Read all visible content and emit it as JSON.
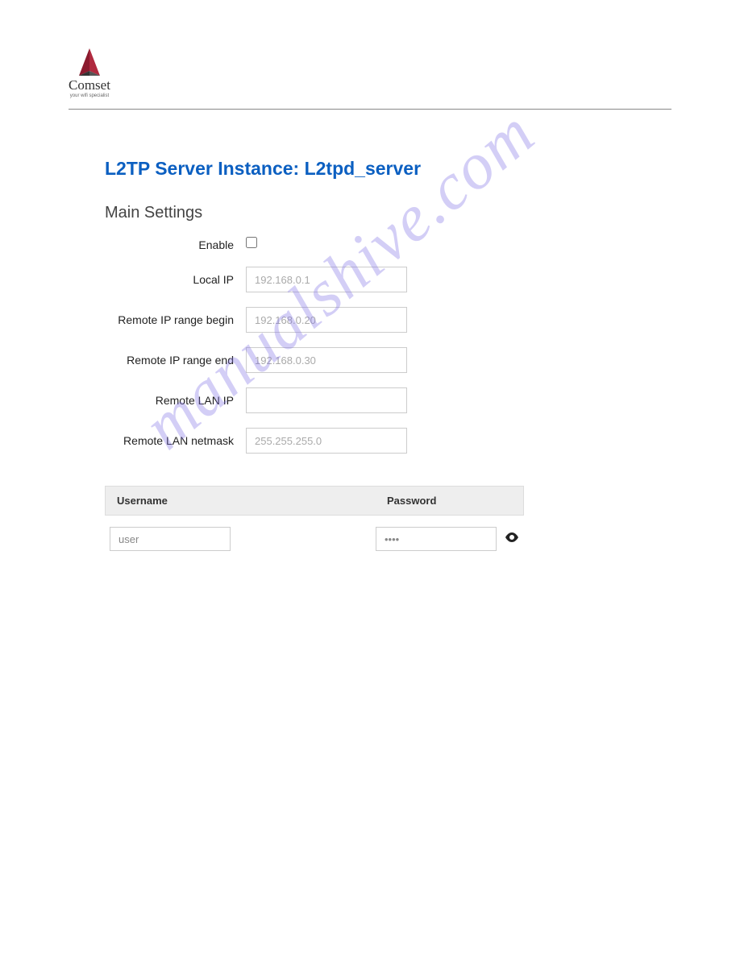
{
  "brand": {
    "name": "Comset",
    "tagline": "your wifi specialist"
  },
  "page": {
    "title": "L2TP Server Instance: L2tpd_server",
    "section_title": "Main Settings"
  },
  "form": {
    "enable": {
      "label": "Enable",
      "checked": false
    },
    "local_ip": {
      "label": "Local IP",
      "placeholder": "192.168.0.1",
      "value": ""
    },
    "remote_ip_begin": {
      "label": "Remote IP range begin",
      "placeholder": "192.168.0.20",
      "value": ""
    },
    "remote_ip_end": {
      "label": "Remote IP range end",
      "placeholder": "192.168.0.30",
      "value": ""
    },
    "remote_lan_ip": {
      "label": "Remote LAN IP",
      "placeholder": "",
      "value": ""
    },
    "remote_lan_netmask": {
      "label": "Remote LAN netmask",
      "placeholder": "255.255.255.0",
      "value": ""
    }
  },
  "credentials": {
    "header_username": "Username",
    "header_password": "Password",
    "rows": [
      {
        "username": "user",
        "password": "••••"
      }
    ]
  },
  "watermark": "manualshive.com"
}
